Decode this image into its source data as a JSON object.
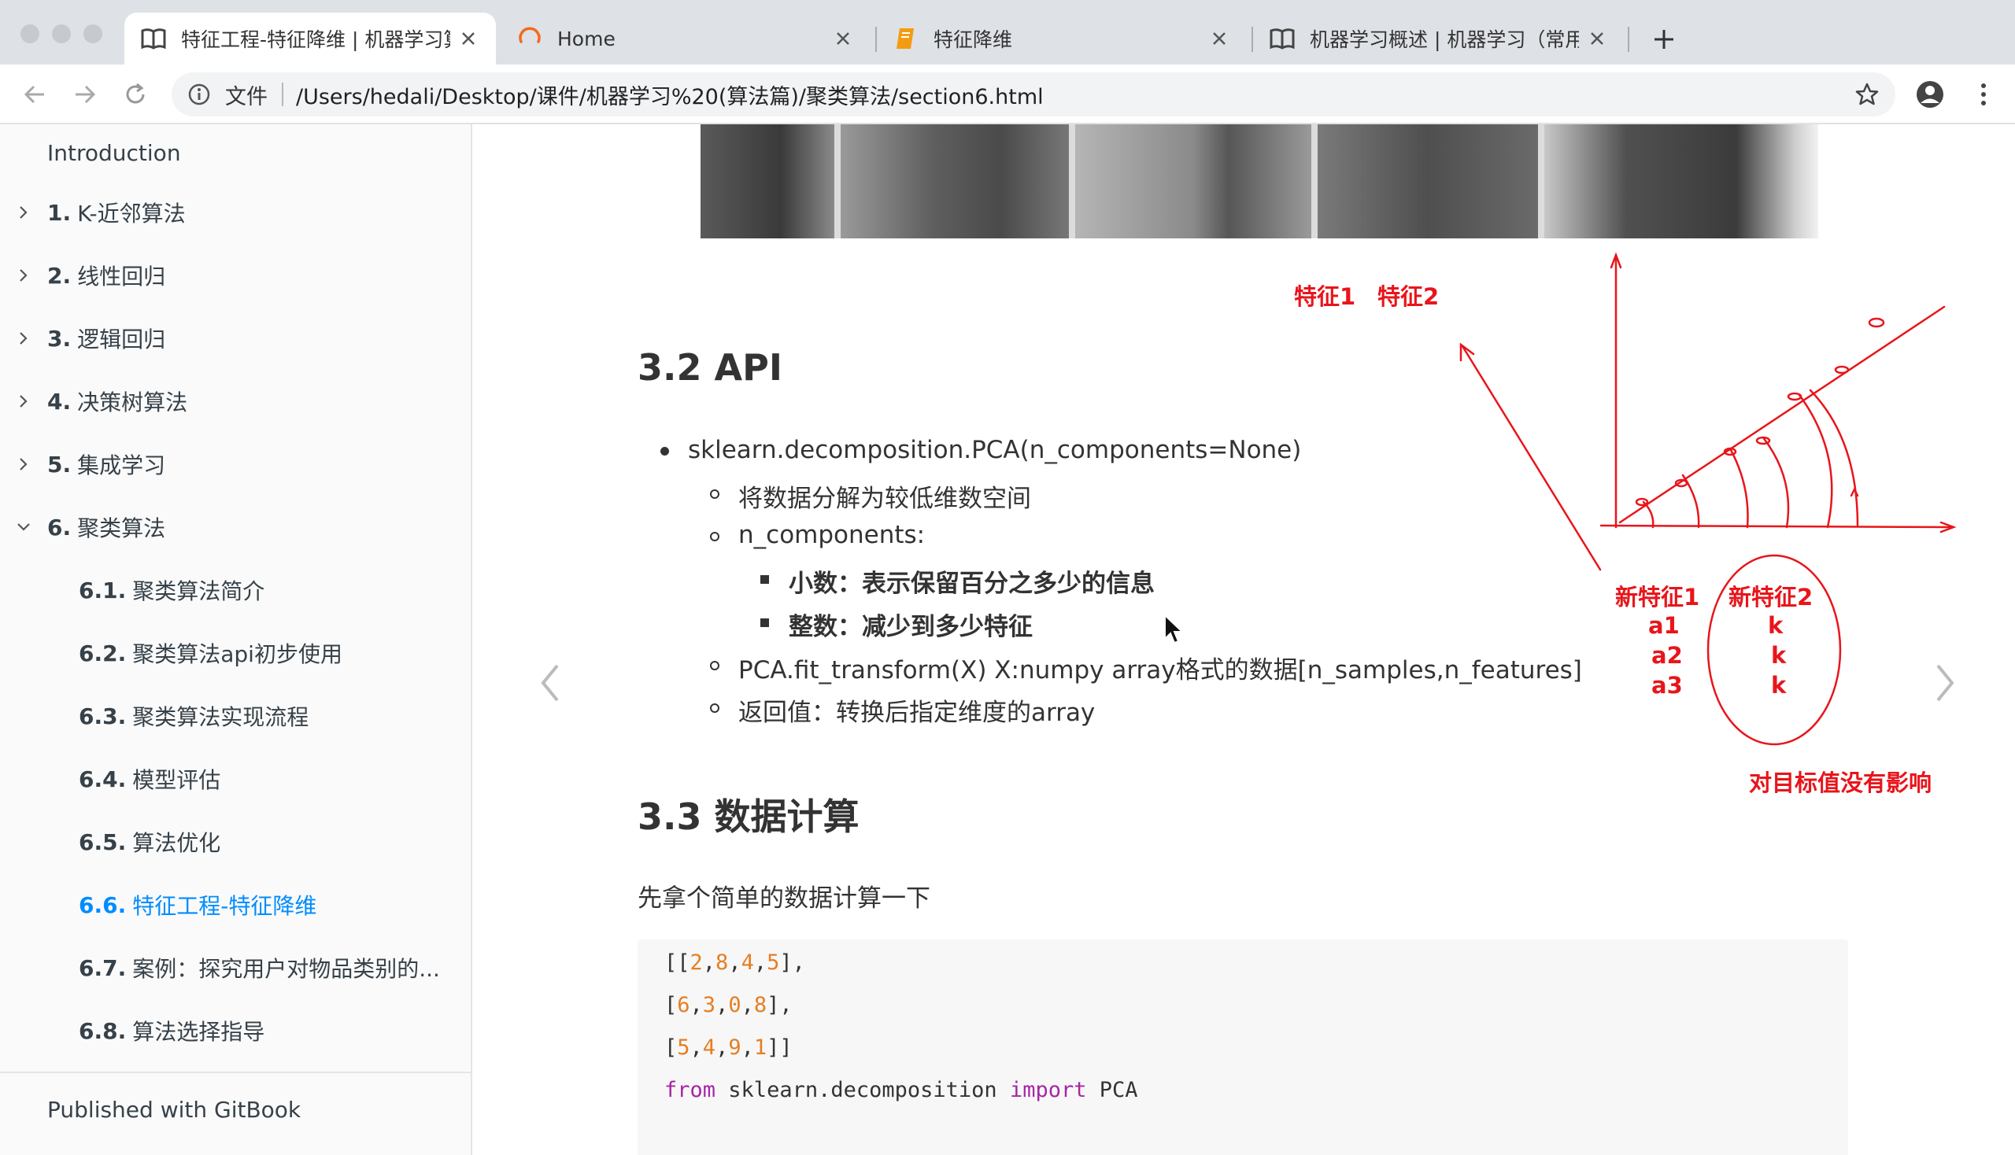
{
  "browser": {
    "tabs": [
      {
        "title": "特征工程-特征降维 | 机器学习算",
        "icon": "book-icon",
        "active": true
      },
      {
        "title": "Home",
        "icon": "loading-spinner-icon",
        "active": false
      },
      {
        "title": "特征降维",
        "icon": "bookmark-doc-icon",
        "active": false
      },
      {
        "title": "机器学习概述 | 机器学习（常用",
        "icon": "book-icon",
        "active": false
      }
    ],
    "address": {
      "scheme_label": "文件",
      "url": "/Users/hedali/Desktop/课件/机器学习%20(算法篇)/聚类算法/section6.html"
    }
  },
  "sidebar": {
    "intro": "Introduction",
    "items": [
      {
        "num": "1.",
        "label": "K-近邻算法"
      },
      {
        "num": "2.",
        "label": "线性回归"
      },
      {
        "num": "3.",
        "label": "逻辑回归"
      },
      {
        "num": "4.",
        "label": "决策树算法"
      },
      {
        "num": "5.",
        "label": "集成学习"
      },
      {
        "num": "6.",
        "label": "聚类算法"
      }
    ],
    "subitems": [
      {
        "num": "6.1.",
        "label": "聚类算法简介"
      },
      {
        "num": "6.2.",
        "label": "聚类算法api初步使用"
      },
      {
        "num": "6.3.",
        "label": "聚类算法实现流程"
      },
      {
        "num": "6.4.",
        "label": "模型评估"
      },
      {
        "num": "6.5.",
        "label": "算法优化"
      },
      {
        "num": "6.6.",
        "label": "特征工程-特征降维"
      },
      {
        "num": "6.7.",
        "label": "案例：探究用户对物品类别的..."
      },
      {
        "num": "6.8.",
        "label": "算法选择指导"
      }
    ],
    "active_subitem": "6.6.",
    "footer": "Published with GitBook"
  },
  "content": {
    "h_api": "3.2 API",
    "api_call": "sklearn.decomposition.PCA(n_components=None)",
    "api_desc": "将数据分解为较低维数空间",
    "n_components": "n_components:",
    "decimal": "小数：表示保留百分之多少的信息",
    "integer": "整数：减少到多少特征",
    "fit_transform": "PCA.fit_transform(X) X:numpy array格式的数据[n_samples,n_features]",
    "return_value": "返回值：转换后指定维度的array",
    "h_calc": "3.3 数据计算",
    "calc_intro": "先拿个简单的数据计算一下",
    "code": {
      "row1": [
        "2",
        "8",
        "4",
        "5"
      ],
      "row2": [
        "6",
        "3",
        "0",
        "8"
      ],
      "row3": [
        "5",
        "4",
        "9",
        "1"
      ],
      "kw_from": "from",
      "module": "sklearn.decomposition",
      "kw_import": "import",
      "name": "PCA"
    }
  },
  "annotation": {
    "feature1": "特征1",
    "feature2": "特征2",
    "new_feature1": "新特征1",
    "new_feature2": "新特征2",
    "col1": [
      "a1",
      "a2",
      "a3"
    ],
    "col2": [
      "k",
      "k",
      "k"
    ],
    "note": "对目标值没有影响",
    "color": "#e8151b"
  }
}
